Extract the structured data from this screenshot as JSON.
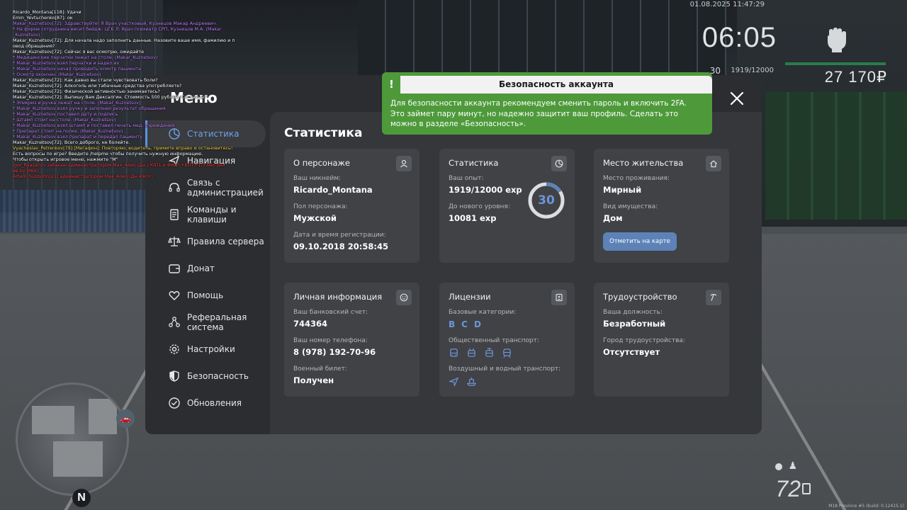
{
  "chat": [
    {
      "text": "Ricardo_Montana[118]: Удачи",
      "color": "w"
    },
    {
      "text": "Emin_Yevtuchenko[87]: ок",
      "color": "w"
    },
    {
      "text": "Makar_Kuznetsov[72]: Здравствуйте! Я Врач участковый, Кузнецов Макар Андреевич.",
      "color": "p"
    },
    {
      "text": "* На форме сотрудника висит бейдж: ЦГБ Л: Врач психиатр СРП, Кузнецов М.А. (Makar",
      "color": "p"
    },
    {
      "text": "_Kuznetsov)",
      "color": "p"
    },
    {
      "text": "Makar_Kuznetsov[72]: Для начала надо заполнить данные. Назовите ваше имя, фамилию и п",
      "color": "w"
    },
    {
      "text": "овод обращения?",
      "color": "w"
    },
    {
      "text": "Makar_Kuznetsov[72]: Сейчас я вас осмотрю, ожидайте",
      "color": "w"
    },
    {
      "text": "* Медицинские перчатки лежат на столе. (Makar_Kuznetsov)",
      "color": "p"
    },
    {
      "text": "* Makar_Kuznetsov взял перчатки и надел их",
      "color": "p"
    },
    {
      "text": "* Makar_Kuznetsov начал проводить осмотр пациента",
      "color": "p"
    },
    {
      "text": "* Осмотр окончен. (Makar_Kuznetsov)",
      "color": "p"
    },
    {
      "text": "Makar_Kuznetsov[72]: Как давно вы стали чувствовать боли?",
      "color": "w"
    },
    {
      "text": "Makar_Kuznetsov[72]: Алкоголь или табачные средства употребляете?",
      "color": "w"
    },
    {
      "text": "Makar_Kuznetsov[72]: Физической активностью занимаетесь?",
      "color": "w"
    },
    {
      "text": "Makar_Kuznetsov[72]: Выпишу Вам Дексалгин. Стоимость 500 рублей. Согласны?",
      "color": "w"
    },
    {
      "text": "* Эпикриз и ручка лежат на столе. (Makar_Kuznetsov)",
      "color": "p"
    },
    {
      "text": "* Makar_Kuznetsov взял ручку и заполнил результат обращения",
      "color": "p"
    },
    {
      "text": "* Makar_Kuznetsov поставил дату и подпись",
      "color": "p"
    },
    {
      "text": "* Штамп стоит на столе. (Makar_Kuznetsov)",
      "color": "p"
    },
    {
      "text": "* Makar_Kuznetsov взял штамп и поставил печать мед. учреждения",
      "color": "p"
    },
    {
      "text": "* Препарат стоит на полке. (Makar_Kuznetsov)",
      "color": "p"
    },
    {
      "text": "* Makar_Kuznetsov взял препарат и передал пациенту",
      "color": "p"
    },
    {
      "text": "Makar_Kuznetsov[72]: Всего доброго, не болейте.",
      "color": "w"
    },
    {
      "text": "Vyacheslav_Petrenkov[79] [Мегафон]: Повторяю, водитель, примите вправо и остановитесь!",
      "color": "y"
    },
    {
      "text": "Есть вопросы по игре? Введите /helpme чтобы получить нужную информацию.",
      "color": "w"
    },
    {
      "text": "Чтобы открыть игровое меню, нажмите \"M\"",
      "color": "w"
    },
    {
      "text": "Igor_Ryazanov забанен администратором Max_Allen (Дн.) ЮП1 и ФЮП +ЮП +1/3 мес рез",
      "color": "r"
    },
    {
      "text": "ев.by MAX)",
      "color": "r"
    },
    {
      "text": "Artem_Subbotin[21] администратором Max_Allen (Дн 490+)",
      "color": "r"
    }
  ],
  "hud": {
    "date": "01.08.2025 11:47:29",
    "time": "06:05",
    "level": "30",
    "exp": "1919/12000",
    "money": "27 170₽",
    "fuel": "72",
    "build": "M18 Province #5 (build: 0.12415.1)",
    "map_north": "N"
  },
  "menu": {
    "title": "Меню",
    "close_label": "×",
    "nav": [
      {
        "label": "Статистика",
        "icon": "pie-chart-icon",
        "active": true
      },
      {
        "label": "Навигация",
        "icon": "navigation-icon"
      },
      {
        "label": "Связь с администрацией",
        "icon": "headset-icon"
      },
      {
        "label": "Команды и клавиши",
        "icon": "document-icon"
      },
      {
        "label": "Правила сервера",
        "icon": "scales-icon"
      },
      {
        "label": "Донат",
        "icon": "wallet-icon"
      },
      {
        "label": "Помощь",
        "icon": "heart-hands-icon"
      },
      {
        "label": "Реферальная система",
        "icon": "referral-icon"
      },
      {
        "label": "Настройки",
        "icon": "gear-icon"
      },
      {
        "label": "Безопасность",
        "icon": "shield-icon"
      },
      {
        "label": "Обновления",
        "icon": "update-icon"
      }
    ]
  },
  "stats": {
    "title": "Статистика",
    "character": {
      "title": "О персонаже",
      "nickname_label": "Ваш никнейм:",
      "nickname": "Ricardo_Montana",
      "gender_label": "Пол персонажа:",
      "gender": "Мужской",
      "reg_label": "Дата и время регистрации:",
      "reg": "09.10.2018 20:58:45"
    },
    "progress": {
      "title": "Статистика",
      "exp_label": "Ваш опыт:",
      "exp": "1919/12000 exp",
      "next_label": "До нового уровня:",
      "next": "10081 exp",
      "level": "30",
      "fraction": 0.16
    },
    "residence": {
      "title": "Место жительства",
      "place_label": "Место проживания:",
      "place": "Мирный",
      "type_label": "Вид имущества:",
      "type": "Дом",
      "map_button": "Отметить на карте"
    },
    "personal": {
      "title": "Личная информация",
      "bank_label": "Ваш банковский счет:",
      "bank": "744364",
      "phone_label": "Ваш номер телефона:",
      "phone": "8 (978) 192-70-96",
      "military_label": "Военный билет:",
      "military": "Получен"
    },
    "licenses": {
      "title": "Лицензии",
      "base_label": "Базовые категории:",
      "base": [
        "B",
        "C",
        "D"
      ],
      "public_label": "Общественный транспорт:",
      "air_label": "Воздушный и водный транспорт:"
    },
    "job": {
      "title": "Трудоустройство",
      "position_label": "Ваша должность:",
      "position": "Безработный",
      "city_label": "Город трудоустройства:",
      "city": "Отсутствует"
    }
  },
  "notice": {
    "mark": "!",
    "title": "Безопасность аккаунта",
    "text": "Для безопасности аккаунта рекомендуем сменить пароль и включить 2FA. Это займет пару минут, но надежно защитит ваш профиль. Сделать это можно в разделе «Безопасность».",
    "color": "#4e9a3b"
  },
  "colors": {
    "accent": "#5d93e2",
    "panel": "#2b2d30",
    "card": "#404246"
  }
}
